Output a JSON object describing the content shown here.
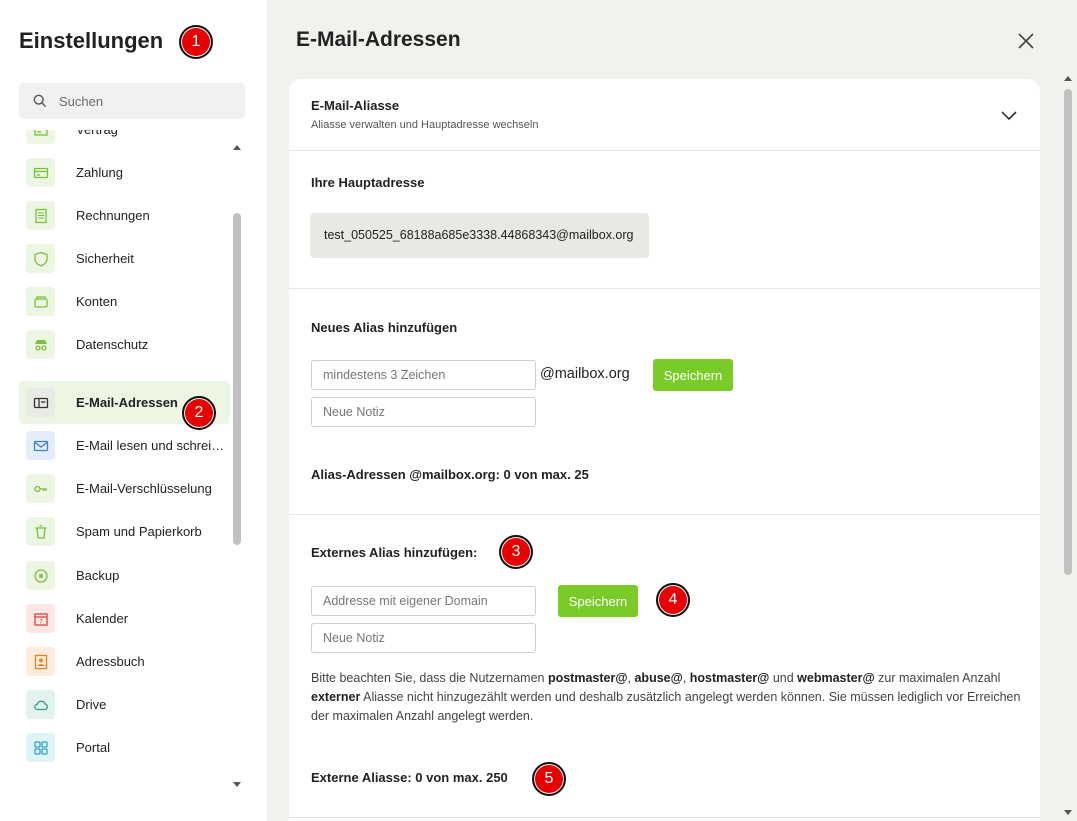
{
  "sidebar": {
    "title": "Einstellungen",
    "search_placeholder": "Suchen",
    "items": [
      {
        "label": "Vertrag",
        "icon": "contract-icon",
        "color": "green"
      },
      {
        "label": "Zahlung",
        "icon": "credit-card-icon",
        "color": "green"
      },
      {
        "label": "Rechnungen",
        "icon": "invoice-icon",
        "color": "green"
      },
      {
        "label": "Sicherheit",
        "icon": "shield-icon",
        "color": "green"
      },
      {
        "label": "Konten",
        "icon": "accounts-icon",
        "color": "green"
      },
      {
        "label": "Datenschutz",
        "icon": "incognito-icon",
        "color": "green"
      },
      {
        "label": "E-Mail-Adressen",
        "icon": "address-card-icon",
        "color": "gray",
        "active": true
      },
      {
        "label": "E-Mail lesen und schreiben",
        "icon": "envelope-icon",
        "color": "blue"
      },
      {
        "label": "E-Mail-Verschlüsselung",
        "icon": "key-icon",
        "color": "green"
      },
      {
        "label": "Spam und Papierkorb",
        "icon": "trash-icon",
        "color": "green"
      },
      {
        "label": "Backup",
        "icon": "backup-icon",
        "color": "green"
      },
      {
        "label": "Kalender",
        "icon": "calendar-icon",
        "color": "red"
      },
      {
        "label": "Adressbuch",
        "icon": "address-book-icon",
        "color": "orange"
      },
      {
        "label": "Drive",
        "icon": "cloud-icon",
        "color": "teal"
      },
      {
        "label": "Portal",
        "icon": "grid-icon",
        "color": "cyan"
      }
    ]
  },
  "main": {
    "title": "E-Mail-Adressen",
    "section": {
      "title": "E-Mail-Aliasse",
      "subtitle": "Aliasse verwalten und Hauptadresse wechseln"
    },
    "primary": {
      "title": "Ihre Hauptadresse",
      "address": "test_050525_68188a685e3338.44868343@mailbox.org"
    },
    "new_alias": {
      "title": "Neues Alias hinzufügen",
      "alias_placeholder": "mindestens 3 Zeichen",
      "domain": "@mailbox.org",
      "note_placeholder": "Neue Notiz",
      "save_label": "Speichern",
      "count_text": "Alias-Adressen @mailbox.org: 0 von max. 25"
    },
    "external_alias": {
      "title": "Externes Alias hinzufügen:",
      "address_placeholder": "Addresse mit eigener Domain",
      "note_placeholder": "Neue Notiz",
      "save_label": "Speichern",
      "note_parts": {
        "p1": "Bitte beachten Sie, dass die Nutzernamen ",
        "b1": "postmaster@",
        "p2": ", ",
        "b2": "abuse@",
        "p3": ", ",
        "b3": "hostmaster@",
        "p4": " und ",
        "b4": "webmaster@",
        "p5": " zur maximalen Anzahl ",
        "b5": "externer",
        "p6": " Aliasse nicht hinzugezählt werden und deshalb zusätzlich angelegt werden können. Sie müssen lediglich vor Erreichen der maximalen Anzahl angelegt werden."
      },
      "count_text": "Externe Aliasse: 0 von max. 250"
    }
  },
  "markers": [
    "1",
    "2",
    "3",
    "4",
    "5"
  ],
  "colors": {
    "accent_green": "#7bcb28",
    "active_bg": "#edf6e3",
    "marker_red": "#e80000"
  }
}
